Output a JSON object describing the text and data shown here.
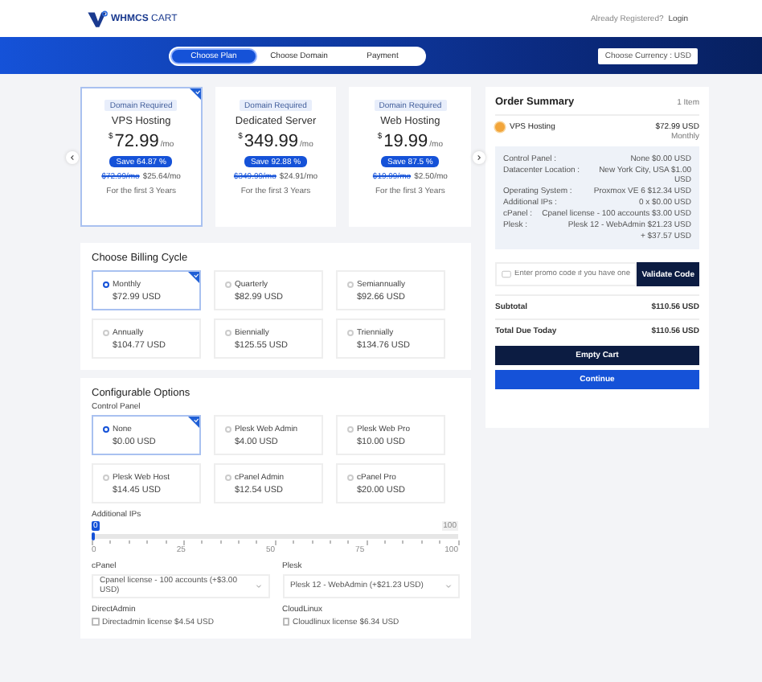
{
  "header": {
    "logo": "**WHMCS** CART",
    "account_prompt": "Already Registered?",
    "login": "Login"
  },
  "steps": [
    {
      "label": "Choose Plan",
      "selected": true
    },
    {
      "label": "Choose Domain",
      "selected": false
    },
    {
      "label": "Payment",
      "selected": false
    }
  ],
  "currency": "Choose Currency : USD",
  "products": [
    {
      "badge": "Domain Required",
      "name": "VPS Hosting",
      "currency": "$",
      "price": "72.99",
      "period": "/mo",
      "selected": true,
      "save": "Save 64.87 %",
      "old_price": "$72.99/mo",
      "new_price": "$25.64/mo",
      "term": "For the first 3 Years"
    },
    {
      "badge": "Domain Required",
      "name": "Dedicated Server",
      "currency": "$",
      "price": "349.99",
      "period": "/mo",
      "selected": false,
      "save": "Save 92.88 %",
      "old_price": "$349.99/mo",
      "new_price": "$24.91/mo",
      "term": "For the first 3 Years"
    },
    {
      "badge": "Domain Required",
      "name": "Web Hosting",
      "currency": "$",
      "price": "19.99",
      "period": "/mo",
      "selected": false,
      "save": "Save 87.5 %",
      "old_price": "$19.99/mo",
      "new_price": "$2.50/mo",
      "term": "For the first 3 Years"
    }
  ],
  "billing": {
    "title": "Choose Billing Cycle",
    "options": [
      {
        "label": "Monthly",
        "price": "$72.99 USD",
        "selected": true
      },
      {
        "label": "Quarterly",
        "price": "$82.99 USD",
        "selected": false
      },
      {
        "label": "Semiannually",
        "price": "$92.66 USD",
        "selected": false
      },
      {
        "label": "Annually",
        "price": "$104.77 USD",
        "selected": false
      },
      {
        "label": "Biennially",
        "price": "$125.55 USD",
        "selected": false
      },
      {
        "label": "Triennially",
        "price": "$134.76 USD",
        "selected": false
      }
    ]
  },
  "config": {
    "title": "Configurable Options",
    "control_panel": {
      "label": "Control Panel",
      "options": [
        {
          "label": "None",
          "price": "$0.00 USD",
          "selected": true
        },
        {
          "label": "Plesk Web Admin",
          "price": "$4.00 USD",
          "selected": false
        },
        {
          "label": "Plesk Web Pro",
          "price": "$10.00 USD",
          "selected": false
        },
        {
          "label": "Plesk Web Host",
          "price": "$14.45 USD",
          "selected": false
        },
        {
          "label": "cPanel Admin",
          "price": "$12.54 USD",
          "selected": false
        },
        {
          "label": "cPanel Pro",
          "price": "$20.00 USD",
          "selected": false
        }
      ]
    },
    "additional_ips": {
      "label": "Additional IPs",
      "value": "0",
      "max": "100",
      "level": 0,
      "ticks": [
        "0",
        "25",
        "50",
        "75",
        "100"
      ]
    },
    "selects": [
      {
        "label": "cPanel",
        "value": "Cpanel license - 100 accounts (+$3.00 USD)"
      },
      {
        "label": "Plesk",
        "value": "Plesk 12 - WebAdmin (+$21.23 USD)"
      }
    ],
    "addons": [
      {
        "label": "DirectAdmin",
        "text": "Directadmin license $4.54 USD",
        "checked": false
      },
      {
        "label": "CloudLinux",
        "text": "Cloudlinux license $6.34 USD",
        "checked": false
      }
    ]
  },
  "summary": {
    "title": "Order Summary",
    "count": "1 Item",
    "item": "VPS Hosting",
    "item_price": "$72.99 USD",
    "item_cycle": "Monthly",
    "details": [
      {
        "label": "Control Panel :",
        "value": "None $0.00 USD"
      },
      {
        "label": "Datacenter Location :",
        "value": "New York City, USA $1.00 USD"
      },
      {
        "label": "Operating System :",
        "value": "Proxmox VE 6 $12.34 USD"
      },
      {
        "label": "Additional IPs :",
        "value": "0 x $0.00 USD"
      },
      {
        "label": "cPanel :",
        "value": "Cpanel license - 100 accounts $3.00 USD"
      },
      {
        "label": "Plesk :",
        "value": "Plesk 12 - WebAdmin $21.23 USD"
      }
    ],
    "details_total": "+ $37.57 USD",
    "promo_placeholder": "Enter promo code if you have one",
    "validate": "Validate Code",
    "subtotal_label": "Subtotal",
    "subtotal": "$110.56 USD",
    "total_label": "Total Due Today",
    "total": "$110.56 USD",
    "empty": "Empty Cart",
    "continue": "Continue"
  }
}
